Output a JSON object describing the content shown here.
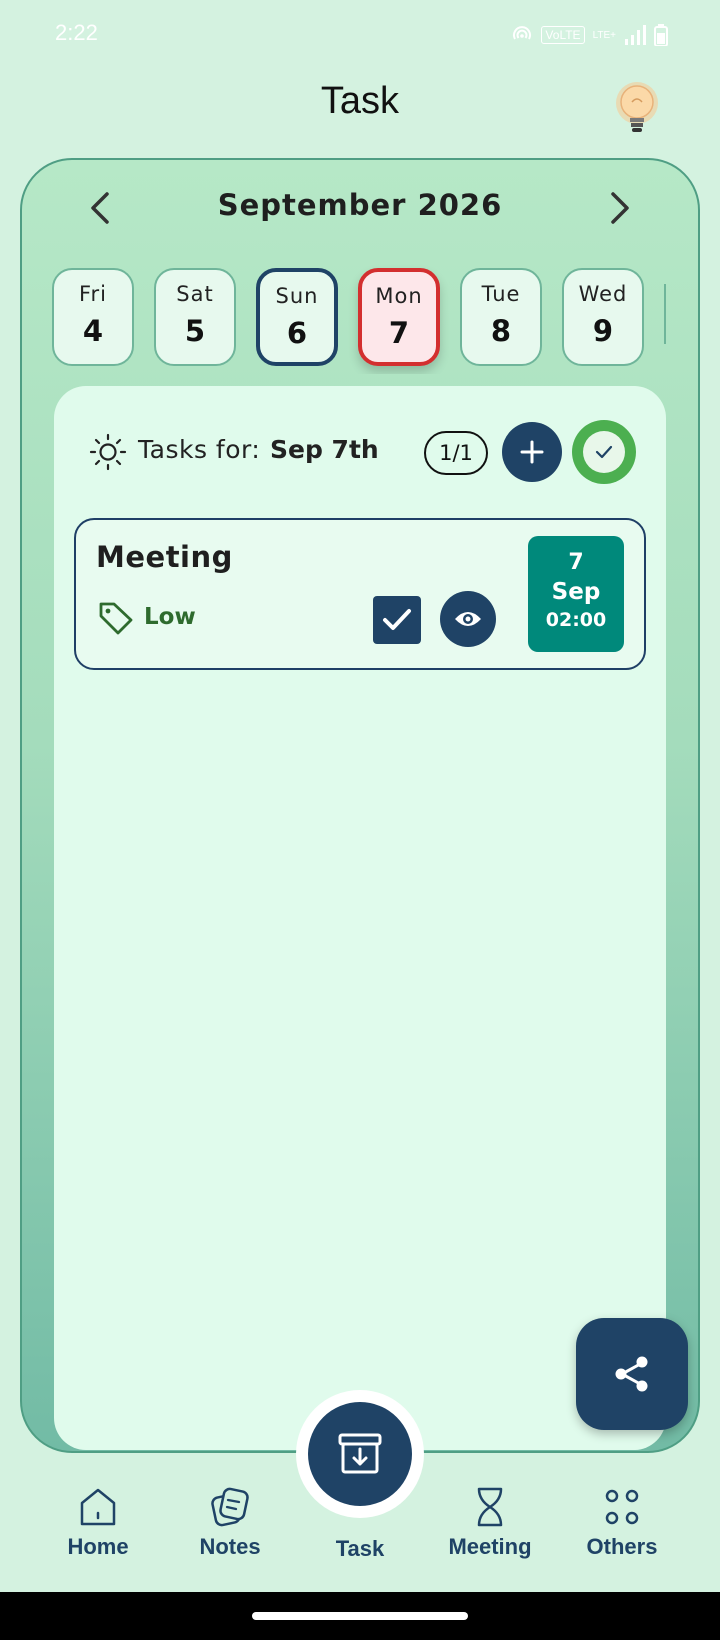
{
  "status_bar": {
    "time": "2:22",
    "volte": "VoLTE",
    "network": "LTE+"
  },
  "header": {
    "title": "Task",
    "bulb_icon": "lightbulb-icon"
  },
  "calendar": {
    "month_title": "September 2026",
    "days": [
      {
        "name": "Fri",
        "num": "4"
      },
      {
        "name": "Sat",
        "num": "5"
      },
      {
        "name": "Sun",
        "num": "6"
      },
      {
        "name": "Mon",
        "num": "7"
      },
      {
        "name": "Tue",
        "num": "8"
      },
      {
        "name": "Wed",
        "num": "9"
      }
    ],
    "today": "Sun 6",
    "selected": "Mon 7"
  },
  "tasks_panel": {
    "label": "Tasks for:",
    "date": "Sep 7th",
    "count": "1/1",
    "tasks": [
      {
        "title": "Meeting",
        "priority": "Low",
        "day": "7",
        "month": "Sep",
        "time": "02:00",
        "completed": true
      }
    ]
  },
  "bottom_nav": {
    "items": [
      {
        "label": "Home"
      },
      {
        "label": "Notes"
      },
      {
        "label": "Task"
      },
      {
        "label": "Meeting"
      },
      {
        "label": "Others"
      }
    ],
    "active": "Task"
  },
  "colors": {
    "background": "#d4f2e0",
    "primary_navy": "#1f4366",
    "selected_border": "#d32f2f",
    "today_border": "#1f4366",
    "date_badge": "#00897b",
    "done_green": "#4caf50",
    "priority_green": "#2e6b2e"
  }
}
